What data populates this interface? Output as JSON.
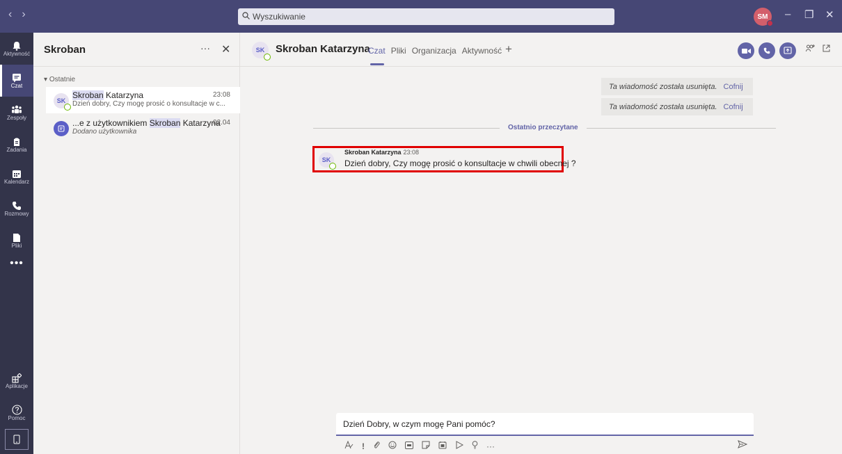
{
  "titlebar": {
    "search_placeholder": "Wyszukiwanie",
    "user_initials": "SM",
    "nav_back": "‹",
    "nav_forward": "›",
    "minimize": "–",
    "maximize": "❐",
    "close": "✕"
  },
  "rail": {
    "items": [
      {
        "label": "Aktywność",
        "icon": "bell-icon"
      },
      {
        "label": "Czat",
        "icon": "chat-icon"
      },
      {
        "label": "Zespoły",
        "icon": "teams-icon"
      },
      {
        "label": "Zadania",
        "icon": "tasks-icon"
      },
      {
        "label": "Kalendarz",
        "icon": "calendar-icon"
      },
      {
        "label": "Rozmowy",
        "icon": "phone-icon"
      },
      {
        "label": "Pliki",
        "icon": "file-icon"
      }
    ],
    "more": "•••",
    "bottom": [
      {
        "label": "Aplikacje",
        "icon": "apps-icon"
      },
      {
        "label": "Pomoc",
        "icon": "help-icon"
      }
    ]
  },
  "list": {
    "title": "Skroban",
    "more": "···",
    "close": "✕",
    "section": "Ostatnie",
    "items": [
      {
        "initials": "SK",
        "name_hl": "Skroban",
        "name_rest": " Katarzyna",
        "time": "23:08",
        "preview": "Dzień dobry, Czy mogę prosić o konsultacje w c..."
      },
      {
        "name_prefix": "...e z użytkownikiem ",
        "name_hl": "Skroban",
        "name_rest": " Katarzyna",
        "time": "02.04",
        "preview": "Dodano użytkownika"
      }
    ]
  },
  "header": {
    "initials": "SK",
    "name": "Skroban Katarzyna",
    "tabs": [
      "Czat",
      "Pliki",
      "Organizacja",
      "Aktywność"
    ],
    "active_tab": "Czat",
    "add_tab": "+"
  },
  "messages": {
    "deleted": [
      {
        "text": "Ta wiadomość została usunięta.",
        "undo": "Cofnij"
      },
      {
        "text": "Ta wiadomość została usunięta.",
        "undo": "Cofnij"
      }
    ],
    "divider": "Ostatnio przeczytane",
    "latest": {
      "initials": "SK",
      "author": "Skroban Katarzyna",
      "time": "23:08",
      "text": "Dzień dobry, Czy mogę prosić o konsultacje w chwili obecnej ?"
    }
  },
  "compose": {
    "value": "Dzień Dobry, w czym mogę Pani pomóc?",
    "toolbar": [
      "format-icon",
      "important-icon",
      "attach-icon",
      "emoji-icon",
      "gif-icon",
      "sticker-icon",
      "meet-icon",
      "stream-icon",
      "praise-icon",
      "more-icon"
    ]
  },
  "colors": {
    "brand": "#6264a7",
    "titlebar": "#464775",
    "rail": "#33344a",
    "highlight_border": "#e00000"
  }
}
